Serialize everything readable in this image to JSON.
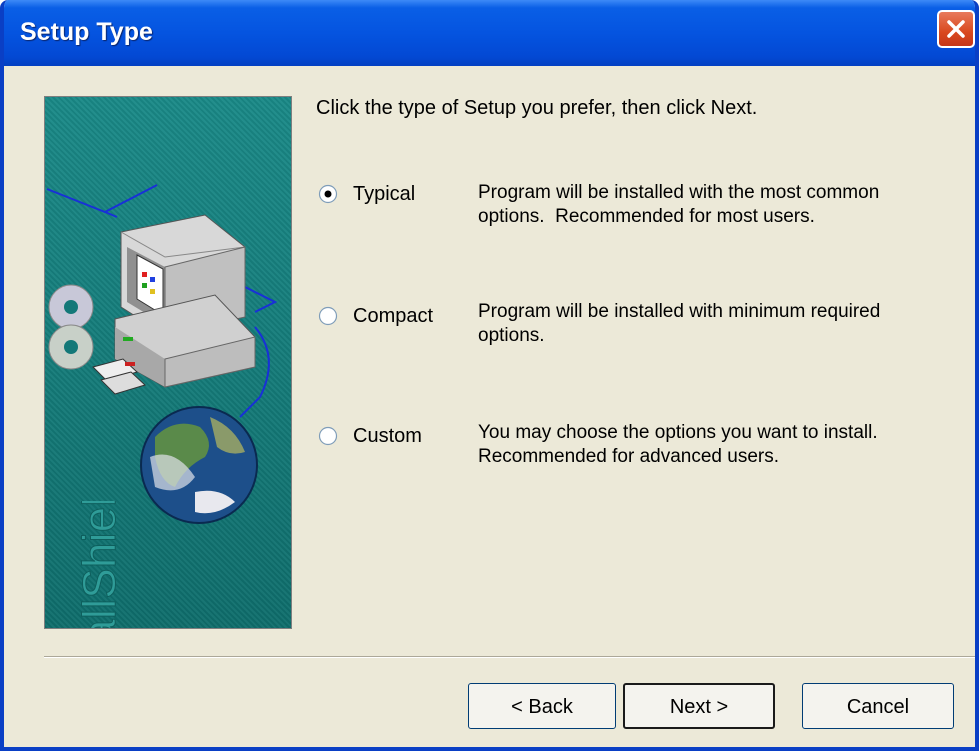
{
  "window": {
    "title": "Setup Type"
  },
  "banner": {
    "brand_text": "InstallShield"
  },
  "instructions": "Click the type of Setup you prefer, then click Next.",
  "options": [
    {
      "label": "Typical",
      "selected": true,
      "description_line1": "Program will be installed with the most common",
      "description_line2": "options.  Recommended for most users."
    },
    {
      "label": "Compact",
      "selected": false,
      "description_line1": "Program will be installed with minimum required",
      "description_line2": "options."
    },
    {
      "label": "Custom",
      "selected": false,
      "description_line1": "You may choose the options you want to install.",
      "description_line2": "Recommended for advanced users."
    }
  ],
  "buttons": {
    "back": "< Back",
    "next": "Next >",
    "cancel": "Cancel"
  },
  "colors": {
    "titlebar": "#0554e0",
    "dialog_bg": "#ece9d8",
    "banner_bg": "#137878",
    "close_button": "#d9481e"
  }
}
